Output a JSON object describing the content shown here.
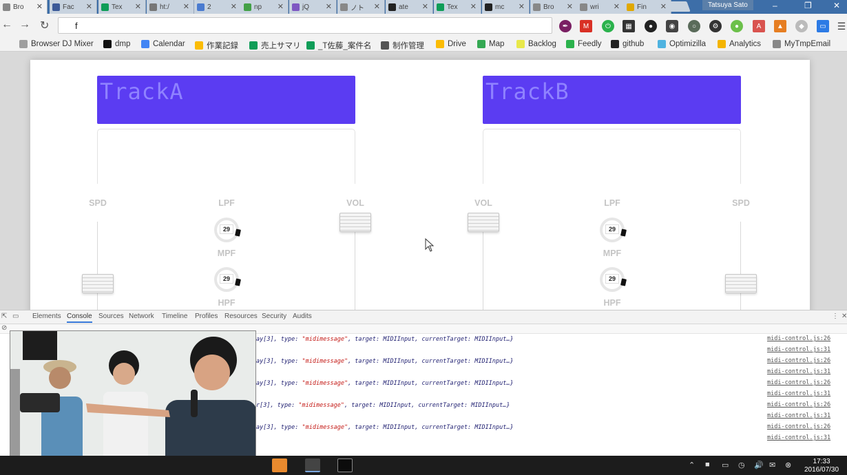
{
  "browser": {
    "tabs": [
      {
        "label": "Bro",
        "color": "#888888",
        "active": true
      },
      {
        "label": "Fac",
        "color": "#3b5998",
        "active": false
      },
      {
        "label": "Tex",
        "color": "#0f9d58",
        "active": false
      },
      {
        "label": "ht:/",
        "color": "#777777",
        "active": false
      },
      {
        "label": "2 ",
        "color": "#4a7bd0",
        "active": false
      },
      {
        "label": "np",
        "color": "#43a047",
        "active": false
      },
      {
        "label": "jQ",
        "color": "#7e57c2",
        "active": false
      },
      {
        "label": "ノト",
        "color": "#888888",
        "active": false
      },
      {
        "label": "ate",
        "color": "#222222",
        "active": false
      },
      {
        "label": "Tex",
        "color": "#0f9d58",
        "active": false
      },
      {
        "label": "mc",
        "color": "#222222",
        "active": false
      },
      {
        "label": "Bro",
        "color": "#888888",
        "active": false
      },
      {
        "label": "wri",
        "color": "#888888",
        "active": false
      },
      {
        "label": "Fin",
        "color": "#e0a800",
        "active": false
      }
    ],
    "profile_name": "Tatsuya Sato",
    "address_value": "f",
    "bookmarks": [
      {
        "label": "Browser DJ Mixer",
        "color": "#9e9e9e"
      },
      {
        "label": "dmp",
        "color": "#111111"
      },
      {
        "label": "Calendar",
        "color": "#4285f4"
      },
      {
        "label": "作業記録",
        "color": "#fbbc05"
      },
      {
        "label": "売上サマリ",
        "color": "#0f9d58"
      },
      {
        "label": "_T佐藤_案件名",
        "color": "#0f9d58"
      },
      {
        "label": "制作管理",
        "color": "#555555"
      },
      {
        "label": "Drive",
        "color": "#fbbc05"
      },
      {
        "label": "Map",
        "color": "#34a853"
      },
      {
        "label": "Backlog",
        "color": "#e8e84a"
      },
      {
        "label": "Feedly",
        "color": "#2bb24c"
      },
      {
        "label": "github",
        "color": "#222222"
      },
      {
        "label": "Optimizilla",
        "color": "#4fb3e0"
      },
      {
        "label": "Analytics",
        "color": "#f4b400"
      },
      {
        "label": "MyTmpEmail",
        "color": "#888888"
      }
    ]
  },
  "mixer": {
    "deckA": {
      "title": "TrackA",
      "spd_label": "SPD",
      "lpf_label": "LPF",
      "mpf_label": "MPF",
      "hpf_label": "HPF",
      "vol_label": "VOL",
      "lpf_value": "29",
      "mpf_value": "29"
    },
    "deckB": {
      "title": "TrackB",
      "spd_label": "SPD",
      "lpf_label": "LPF",
      "mpf_label": "MPF",
      "hpf_label": "HPF",
      "vol_label": "VOL",
      "lpf_value": "29",
      "mpf_value": "29"
    }
  },
  "devtools": {
    "tabs": [
      "Elements",
      "Console",
      "Sources",
      "Network",
      "Timeline",
      "Profiles",
      "Resources",
      "Security",
      "Audits"
    ],
    "active_tab": "Console",
    "log_lines": [
      {
        "prefix": "ay[3], type: ",
        "type_str": "\"midimessage\"",
        "rest": ", target: MIDIInput, currentTarget: MIDIInput…}",
        "src": "midi-control.js:26"
      },
      {
        "prefix": "",
        "type_str": "",
        "rest": "",
        "src": "midi-control.js:31"
      },
      {
        "prefix": "ay[3], type: ",
        "type_str": "\"midimessage\"",
        "rest": ", target: MIDIInput, currentTarget: MIDIInput…}",
        "src": "midi-control.js:26"
      },
      {
        "prefix": "",
        "type_str": "",
        "rest": "",
        "src": "midi-control.js:31"
      },
      {
        "prefix": "ay[3], type: ",
        "type_str": "\"midimessage\"",
        "rest": ", target: MIDIInput, currentTarget: MIDIInput…}",
        "src": "midi-control.js:26"
      },
      {
        "prefix": "",
        "type_str": "",
        "rest": "",
        "src": "midi-control.js:31"
      },
      {
        "prefix": "r[3], type: ",
        "type_str": "\"midimessage\"",
        "rest": ", target: MIDIInput, currentTarget: MIDIInput…}",
        "src": "midi-control.js:26"
      },
      {
        "prefix": "",
        "type_str": "",
        "rest": "",
        "src": "midi-control.js:31"
      },
      {
        "prefix": "ay[3], type: ",
        "type_str": "\"midimessage\"",
        "rest": ", target: MIDIInput, currentTarget: MIDIInput…}",
        "src": "midi-control.js:26"
      },
      {
        "prefix": "",
        "type_str": "",
        "rest": "",
        "src": "midi-control.js:31"
      }
    ]
  },
  "taskbar": {
    "time": "17:33",
    "date": "2016/07/30"
  }
}
